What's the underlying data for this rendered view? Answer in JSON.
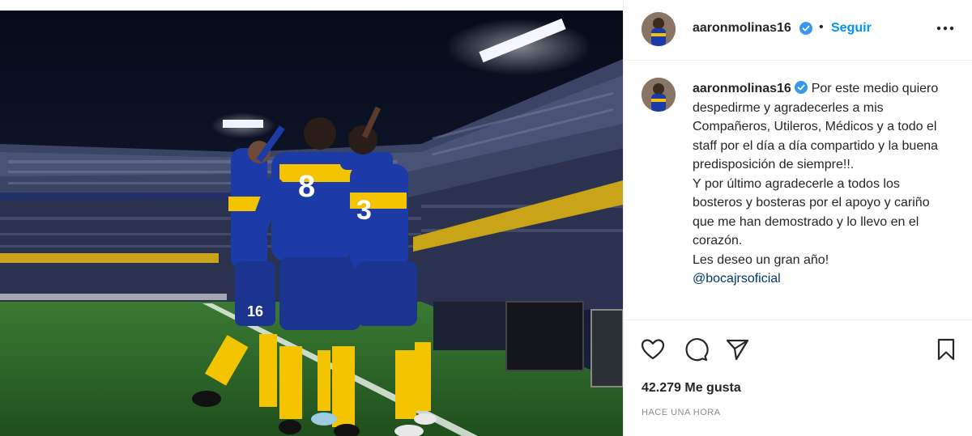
{
  "post": {
    "username": "aaronmolinas16",
    "verified": true,
    "follow_label": "Seguir",
    "separator": "•",
    "more_icon": "more-options-icon"
  },
  "caption": {
    "username": "aaronmolinas16",
    "text_lines": [
      "Por este medio quiero despedirme y agradecerles a mis Compañeros, Utileros, Médicos y a todo el staff por el día a día compartido y la buena predisposición de siempre!!.",
      "Y por último agradecerle a todos los bosteros y bosteras por el apoyo y cariño que me han demostrado y lo llevo en el corazón.",
      "Les deseo un gran año!"
    ],
    "mention": "@bocajrsoficial"
  },
  "actions": {
    "like_icon": "heart-icon",
    "comment_icon": "comment-icon",
    "share_icon": "share-icon",
    "save_icon": "bookmark-icon"
  },
  "likes_text": "42.279 Me gusta",
  "time_text": "HACE UNA HORA",
  "colors": {
    "link_blue": "#0095f6",
    "verified_blue": "#3897f0",
    "mention_blue": "#00376b",
    "jersey_blue": "#1c3aa8",
    "jersey_yellow": "#f5c400",
    "pitch_green": "#2e6b2a"
  },
  "jersey_numbers": [
    "8",
    "16",
    "3"
  ]
}
